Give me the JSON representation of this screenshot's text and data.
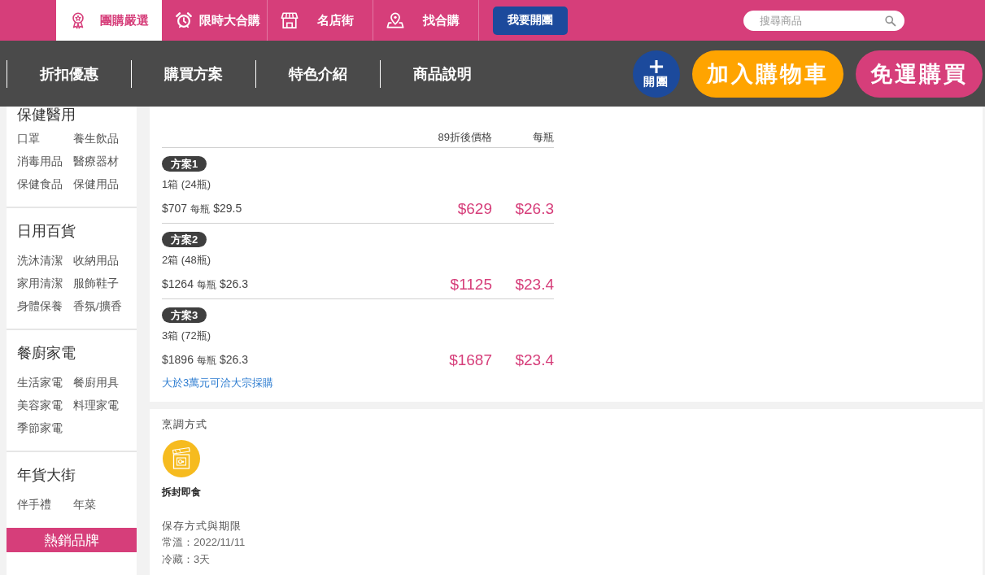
{
  "header": {
    "nav": [
      {
        "label": "團購嚴選",
        "selected": true
      },
      {
        "label": "限時大合購",
        "selected": false
      },
      {
        "label": "名店街",
        "selected": false
      },
      {
        "label": "找合購",
        "selected": false
      }
    ],
    "start_group_button": "我要開團",
    "search": {
      "placeholder": "搜尋商品"
    }
  },
  "section_tabs": [
    {
      "label": "折扣優惠"
    },
    {
      "label": "購買方案"
    },
    {
      "label": "特色介紹"
    },
    {
      "label": "商品說明"
    }
  ],
  "actions": {
    "open_group_button": "開團",
    "add_to_cart_button": "加入購物車",
    "free_shipping_buy_button": "免運購買"
  },
  "sidebar": {
    "categories": [
      {
        "title": "保健醫用",
        "items": [
          "口罩",
          "養生飲品",
          "消毒用品",
          "醫療器材",
          "保健食品",
          "保健用品"
        ]
      },
      {
        "title": "日用百貨",
        "items": [
          "洗沐清潔",
          "收納用品",
          "家用清潔",
          "服飾鞋子",
          "身體保養",
          "香氛/擴香"
        ]
      },
      {
        "title": "餐廚家電",
        "items": [
          "生活家電",
          "餐廚用具",
          "美容家電",
          "料理家電",
          "季節家電"
        ]
      },
      {
        "title": "年貨大街",
        "items": [
          "伴手禮",
          "年菜"
        ]
      }
    ],
    "banner": "熱銷品牌"
  },
  "plans": {
    "columns": [
      "89折後價格",
      "每瓶"
    ],
    "rows": [
      {
        "badge": "方案1",
        "quantity": "1箱 (24瓶)",
        "list_price": "$707",
        "unit_label": "每瓶",
        "list_unit_price": "$29.5",
        "discount_price": "$629",
        "discount_unit_price": "$26.3"
      },
      {
        "badge": "方案2",
        "quantity": "2箱 (48瓶)",
        "list_price": "$1264",
        "unit_label": "每瓶",
        "list_unit_price": "$26.3",
        "discount_price": "$1125",
        "discount_unit_price": "$23.4"
      },
      {
        "badge": "方案3",
        "quantity": "3箱 (72瓶)",
        "list_price": "$1896",
        "unit_label": "每瓶",
        "list_unit_price": "$26.3",
        "discount_price": "$1687",
        "discount_unit_price": "$23.4"
      }
    ],
    "bulk_purchase_link": "大於3萬元可洽大宗採購"
  },
  "details": {
    "cooking_title": "烹調方式",
    "cooking_methods": [
      {
        "label": "拆封即食"
      }
    ],
    "storage_title": "保存方式與期限",
    "storage_lines": [
      "常溫：2022/11/11",
      "冷藏：3天"
    ]
  }
}
